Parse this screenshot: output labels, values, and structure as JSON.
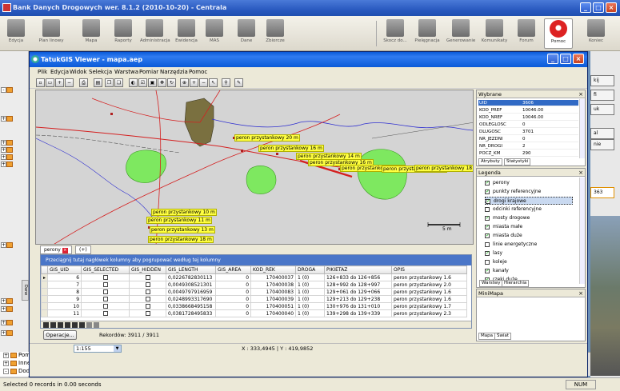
{
  "outer": {
    "title": "Bank Danych Drogowych wer. 8.1.2 (2010-10-20) - Centrala",
    "toolbar": [
      "Edycja",
      "Plan linowy",
      "Mapa",
      "Raporty",
      "Administracja",
      "Ewidencja",
      "MAS",
      "Dane",
      "Zbiorcze",
      "Skocz do...",
      "Pielęgnacja",
      "Generowanie",
      "Komunikaty",
      "Forum",
      "Pomoc",
      "Koniec"
    ],
    "status": "Selected 0 records in 0.00 seconds",
    "num": "NUM",
    "tree_items": [
      "Pomiary ruchu",
      "Inne",
      "Dodatkowe informacje"
    ],
    "dane_tab": "Dane",
    "right_buttons": [
      "kij",
      "fi",
      "uk",
      "al",
      "nie"
    ],
    "right_value": "363"
  },
  "viewer": {
    "title": "TatukGIS Viewer - mapa.aep",
    "menu": [
      "Plik",
      "Edycja",
      "Widok",
      "Selekcja",
      "Warstwa",
      "Pomiar",
      "Narzędzia",
      "Pomoc"
    ],
    "map_labels": [
      "peron przystankowy 20 m",
      "peron przystankowy 16 m",
      "peron przystankowy 14 m",
      "peron przystankowy 16 m",
      "peron przystankowy 18 m",
      "peron przystankowy 16 m",
      "peron przystankowy 18 m",
      "peron przystankowy 10 m",
      "peron przystankowy 11 m",
      "peron przystankowy 13 m",
      "peron przystankowy 18 m"
    ],
    "scale_label": "5 m",
    "tabs": {
      "first": "perony",
      "plus": "(+)"
    },
    "group_hint": "Przeciągnij tutaj nagłówek kolumny aby pogrupować według tej kolumny",
    "columns": [
      "GIS_UID",
      "GIS_SELECTED",
      "GIS_HIDDEN",
      "GIS_LENGTH",
      "GIS_AREA",
      "KOD_REK",
      "DROGA",
      "PIKIETAZ",
      "OPIS"
    ],
    "rows": [
      {
        "uid": "6",
        "length": "0,0226782830113",
        "area": "0",
        "kod": "170400037",
        "droga": "1 (0)",
        "pik": "126+833 do 126+856",
        "opis": "peron przystankowy 1.6"
      },
      {
        "uid": "7",
        "length": "0,0049308521301",
        "area": "0",
        "kod": "170400038",
        "droga": "1 (0)",
        "pik": "128+992 do 128+997",
        "opis": "peron przystankowy 2.0"
      },
      {
        "uid": "8",
        "length": "0,0049797916959",
        "area": "0",
        "kod": "170400083",
        "droga": "1 (0)",
        "pik": "129+061 do 129+066",
        "opis": "peron przystankowy 1.6"
      },
      {
        "uid": "9",
        "length": "0,0248993317690",
        "area": "0",
        "kod": "170400039",
        "droga": "1 (0)",
        "pik": "129+213 do 129+238",
        "opis": "peron przystankowy 1.6"
      },
      {
        "uid": "10",
        "length": "0,0338668495158",
        "area": "0",
        "kod": "170400051",
        "droga": "1 (0)",
        "pik": "130+976 do 131+010",
        "opis": "peron przystankowy 1.7"
      },
      {
        "uid": "11",
        "length": "0,0381728495833",
        "area": "0",
        "kod": "170400040",
        "droga": "1 (0)",
        "pik": "139+298 do 139+339",
        "opis": "peron przystankowy 2.3"
      }
    ],
    "operations_button": "Operacje...",
    "records": "Rekordów: 3911 / 3911",
    "scale": "1:155",
    "coords": "X : 333,4945 | Y : 419,9852"
  },
  "wybrane": {
    "title": "Wybrane",
    "rows": [
      {
        "k": "UID",
        "v": "3606"
      },
      {
        "k": "KOD_PREF",
        "v": "10046.00"
      },
      {
        "k": "KOD_NREF",
        "v": "10046.00"
      },
      {
        "k": "ODLEGLOSC",
        "v": "0"
      },
      {
        "k": "DLUGOSC",
        "v": "3701"
      },
      {
        "k": "NR_JEZDNI",
        "v": "0"
      },
      {
        "k": "NR_DROGI",
        "v": "2"
      },
      {
        "k": "POCZ_KM",
        "v": "290"
      }
    ],
    "tabs": [
      "Atrybuty",
      "Statystyki"
    ]
  },
  "legenda": {
    "title": "Legenda",
    "items": [
      {
        "label": "perony",
        "checked": true
      },
      {
        "label": "punkty referencyjne",
        "checked": true
      },
      {
        "label": "drogi krajowe",
        "checked": true
      },
      {
        "label": "odcinki referencyjne",
        "checked": false
      },
      {
        "label": "mosty drogowe",
        "checked": true
      },
      {
        "label": "miasta małe",
        "checked": true
      },
      {
        "label": "miasta duże",
        "checked": true
      },
      {
        "label": "linie energetyczne",
        "checked": false
      },
      {
        "label": "lasy",
        "checked": true
      },
      {
        "label": "koleje",
        "checked": false
      },
      {
        "label": "kanały",
        "checked": true
      },
      {
        "label": "rzeki duże",
        "checked": true
      }
    ],
    "tabs": [
      "Warstwy",
      "Hierarchia"
    ]
  },
  "minimapa": {
    "title": "MiniMapa",
    "tabs": [
      "Mapa",
      "Świat"
    ]
  },
  "colors": {
    "forest": "#7ee860",
    "city": "#7a7040",
    "road": "#d42020",
    "river": "#3030d0",
    "label_bg": "#ffff40"
  }
}
